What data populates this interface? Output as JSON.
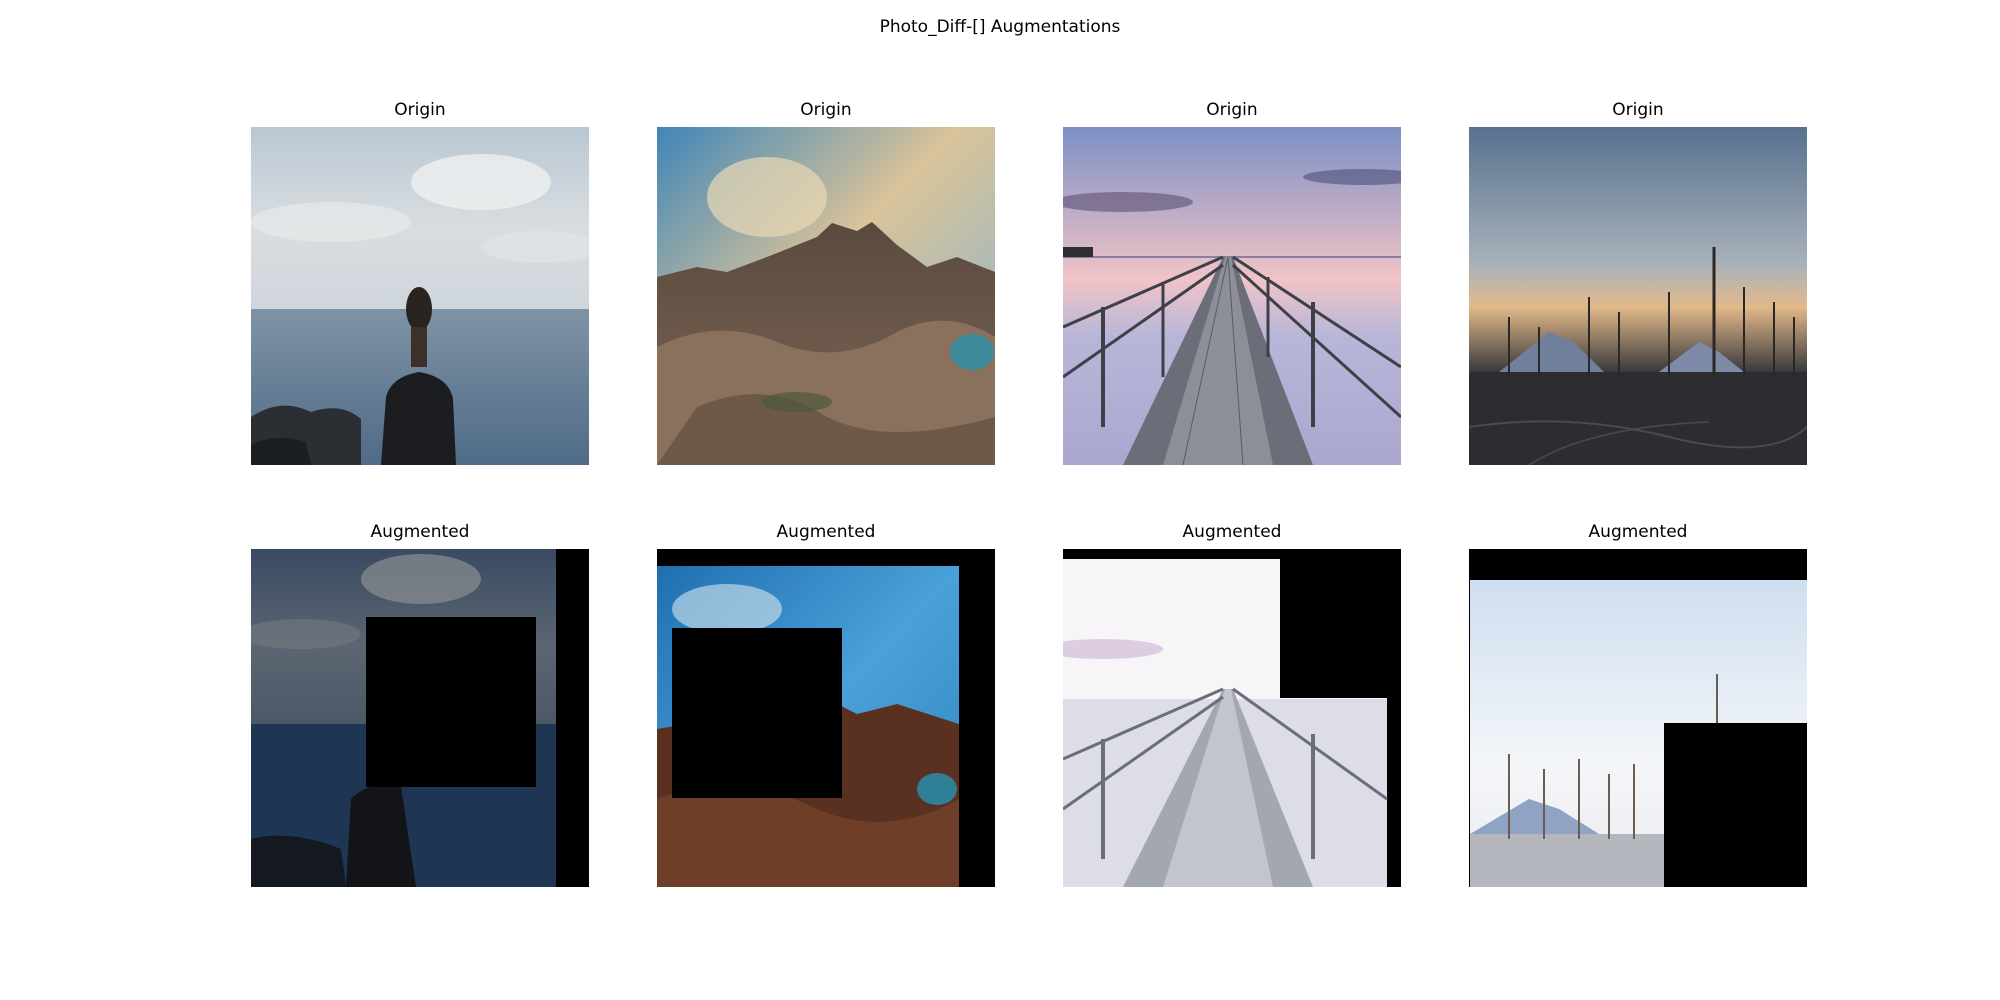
{
  "figure": {
    "title": "Photo_Diff-[] Augmentations"
  },
  "rows": [
    {
      "label": "Origin",
      "kind": "original"
    },
    {
      "label": "Augmented",
      "kind": "augmented"
    }
  ],
  "panels": {
    "p1": {
      "title": "Origin",
      "scene": "person-looking-at-sea"
    },
    "p2": {
      "title": "Origin",
      "scene": "rocky-canyon-sky"
    },
    "p3": {
      "title": "Origin",
      "scene": "wooden-pier-sunset"
    },
    "p4": {
      "title": "Origin",
      "scene": "dead-trees-mountains-dusk"
    },
    "p5": {
      "title": "Augmented",
      "scene": "person-looking-at-sea-darkened-with-occlusion"
    },
    "p6": {
      "title": "Augmented",
      "scene": "rocky-canyon-sky-saturated-with-occlusion"
    },
    "p7": {
      "title": "Augmented",
      "scene": "wooden-pier-overexposed-with-occlusion"
    },
    "p8": {
      "title": "Augmented",
      "scene": "dead-trees-overexposed-with-occlusion"
    }
  }
}
